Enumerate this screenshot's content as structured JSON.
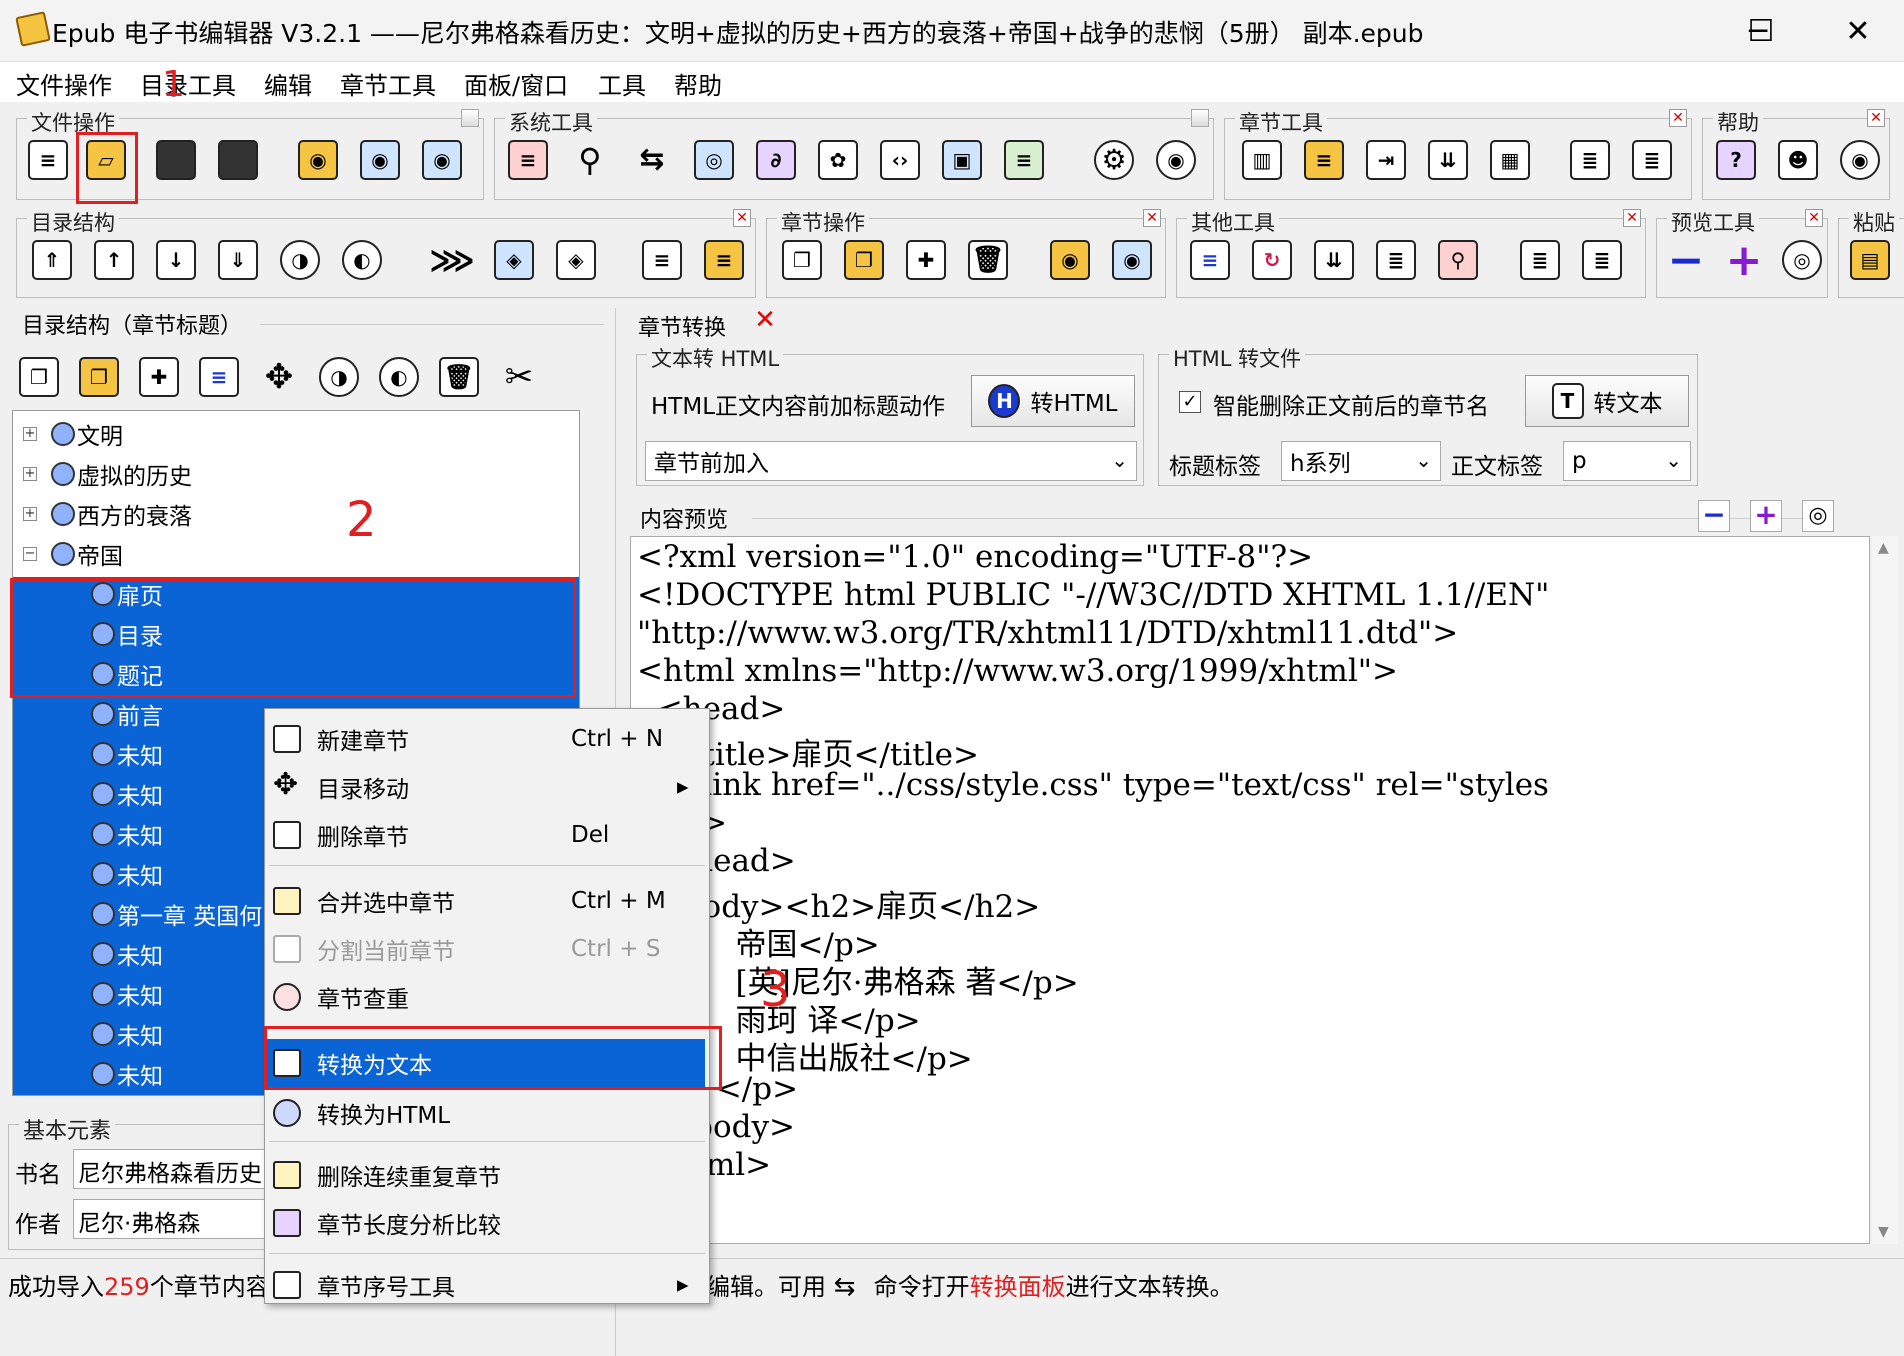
{
  "window": {
    "title": "Epub 电子书编辑器 V3.2.1 ——尼尔弗格森看历史：文明+虚拟的历史+西方的衰落+帝国+战争的悲悯（5册） 副本.epub",
    "min": "─",
    "max": "☐",
    "close": "✕"
  },
  "menu": [
    "文件操作",
    "目录工具",
    "编辑",
    "章节工具",
    "面板/窗口",
    "工具",
    "帮助"
  ],
  "toolbar_groups": {
    "file": "文件操作",
    "system": "系统工具",
    "chapter_tools": "章节工具",
    "help": "帮助",
    "toc": "目录结构",
    "chapter_ops": "章节操作",
    "other": "其他工具",
    "preview": "预览工具",
    "paste": "粘贴"
  },
  "annotations": {
    "a1": "1",
    "a2": "2",
    "a3": "3"
  },
  "toc_panel": {
    "title": "目录结构（章节标题）",
    "nodes": [
      "文明",
      "虚拟的历史",
      "西方的衰落",
      "帝国",
      "扉页",
      "目录",
      "题记",
      "前言",
      "未知",
      "未知",
      "未知",
      "未知",
      "第一章 英国何",
      "未知",
      "未知",
      "未知",
      "未知"
    ],
    "expanders": [
      "+",
      "+",
      "+",
      "−"
    ]
  },
  "basic": {
    "title": "基本元素",
    "book_label": "书名",
    "book_value": "尼尔弗格森看历史",
    "author_label": "作者",
    "author_value": "尼尔·弗格森"
  },
  "convert_panel": {
    "title": "章节转换",
    "text_to_html_label": "文本转 HTML",
    "action_label": "HTML正文内容前加标题动作",
    "to_html_btn": "转HTML",
    "position_value": "章节前加入",
    "html_to_text_label": "HTML 转文件",
    "smart_delete_label": "智能删除正文前后的章节名",
    "smart_delete_checked": true,
    "to_text_btn": "转文本",
    "title_tag_label": "标题标签",
    "title_tag_value": "h系列",
    "body_tag_label": "正文标签",
    "body_tag_value": "p"
  },
  "preview": {
    "title": "内容预览",
    "code": [
      "<?xml version=\"1.0\" encoding=\"UTF-8\"?>",
      "<!DOCTYPE html PUBLIC \"-//W3C//DTD XHTML 1.1//EN\"",
      "\"http://www.w3.org/TR/xhtml11/DTD/xhtml11.dtd\">",
      "<html xmlns=\"http://www.w3.org/1999/xhtml\">",
      "  <head>",
      "    <title>扉页</title>",
      "    <link href=\"../css/style.css\" type=\"text/css\" rel=\"styles",
      "    \"/>",
      "  </head>",
      "  <body><h2>扉页</h2>",
      "          帝国</p>",
      "          [英]尼尔·弗格森 著</p>",
      "          雨珂 译</p>",
      "          中信出版社</p>",
      "        </p>",
      "  </body>",
      "</html>"
    ]
  },
  "context_menu": [
    {
      "label": "新建章节",
      "shortcut": "Ctrl + N"
    },
    {
      "label": "目录移动",
      "shortcut": "▸"
    },
    {
      "label": "删除章节",
      "shortcut": "Del"
    },
    {
      "label": "合并选中章节",
      "shortcut": "Ctrl + M"
    },
    {
      "label": "分割当前章节",
      "shortcut": "Ctrl + S",
      "disabled": true
    },
    {
      "label": "章节查重",
      "shortcut": ""
    },
    {
      "label": "转换为文本",
      "shortcut": "",
      "highlighted": true
    },
    {
      "label": "转换为HTML",
      "shortcut": ""
    },
    {
      "label": "删除连续重复章节",
      "shortcut": ""
    },
    {
      "label": "章节长度分析比较",
      "shortcut": ""
    },
    {
      "label": "章节序号工具",
      "shortcut": "▸"
    }
  ],
  "status": {
    "left_pre": "成功导入",
    "count": "259",
    "left_post": "个章节内容",
    "right_a": "编辑。可用",
    "right_b": "命令打开",
    "right_link": "转换面板",
    "right_c": "进行文本转换。"
  },
  "colors": {
    "selection": "#0a64d6",
    "annotation": "#e02020",
    "highlight": "#0a64d6"
  }
}
